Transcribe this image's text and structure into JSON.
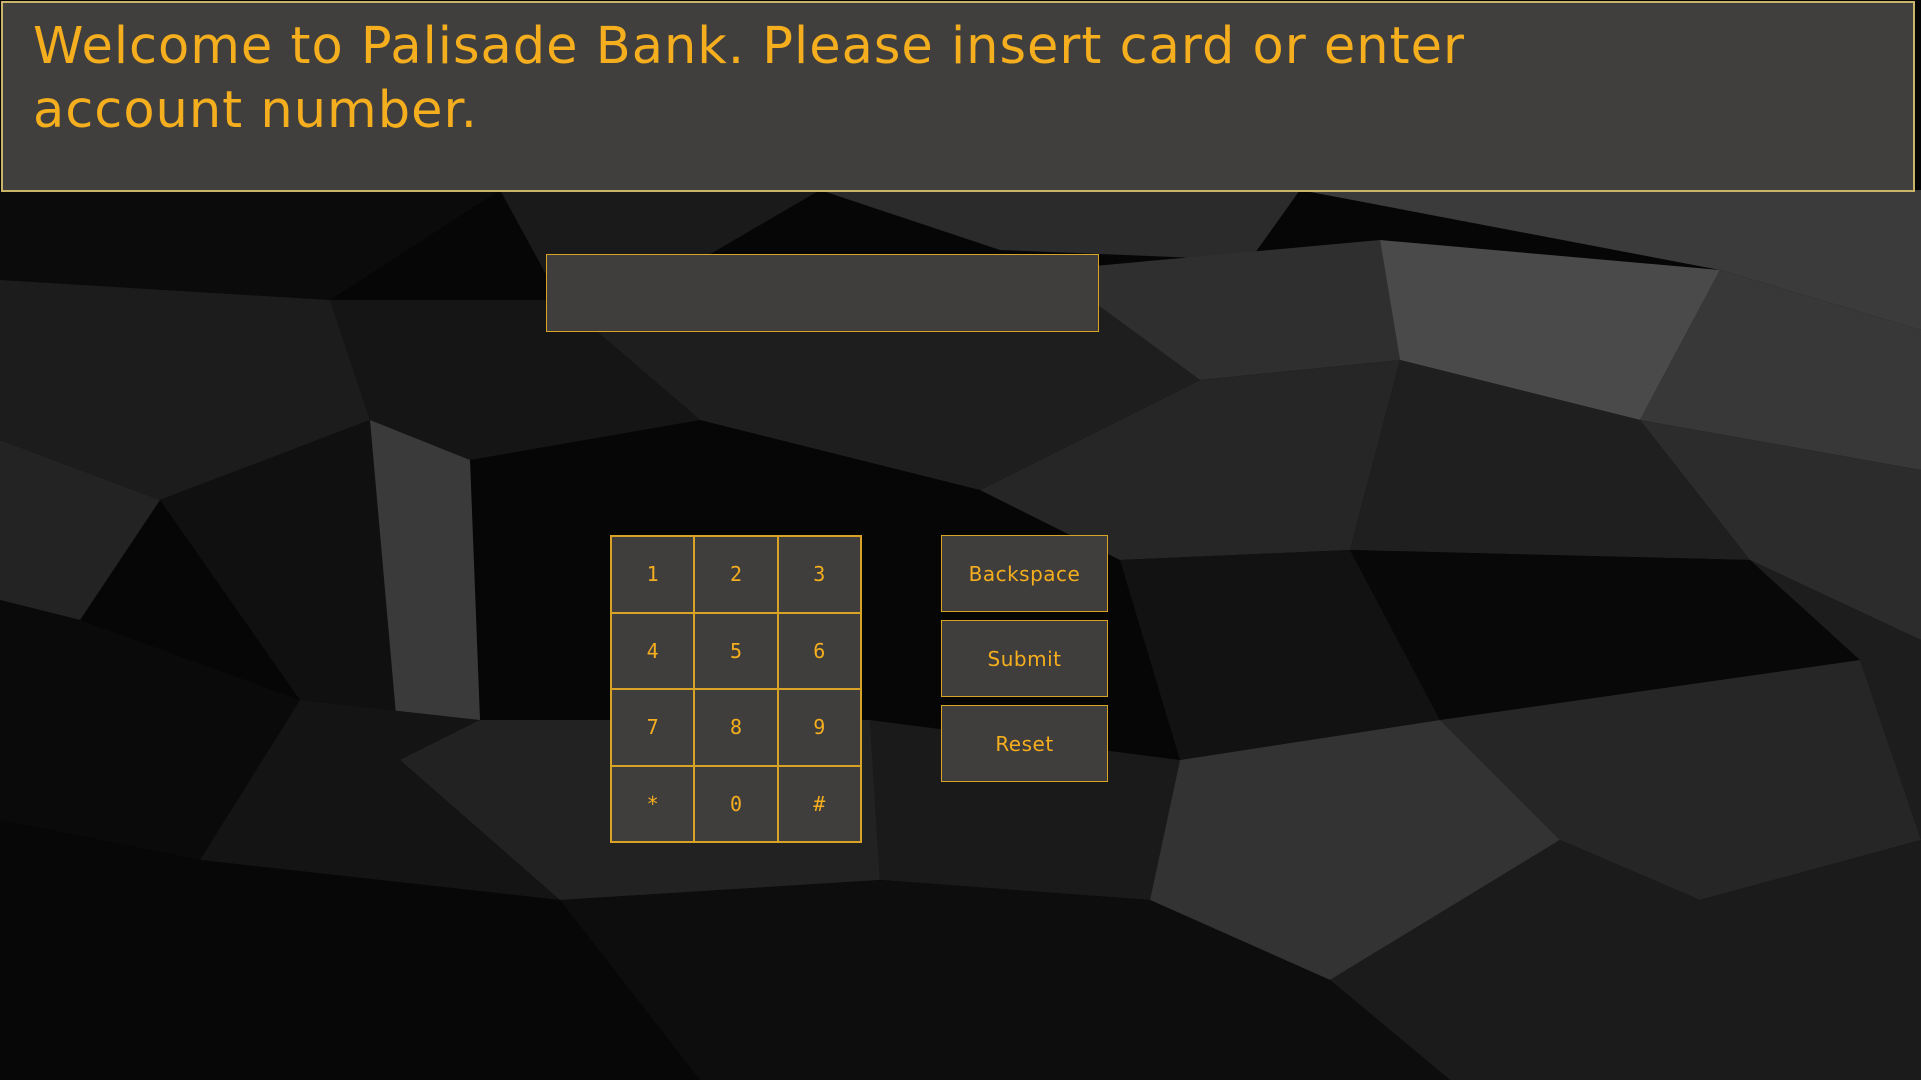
{
  "banner": {
    "message": "Welcome to Palisade Bank. Please insert card or enter account number."
  },
  "account_input": {
    "value": "",
    "placeholder": ""
  },
  "keypad": {
    "keys": [
      "1",
      "2",
      "3",
      "4",
      "5",
      "6",
      "7",
      "8",
      "9",
      "*",
      "0",
      "#"
    ]
  },
  "actions": {
    "backspace_label": "Backspace",
    "submit_label": "Submit",
    "reset_label": "Reset"
  },
  "colors": {
    "accent": "#f5ae1d",
    "border": "#d9a425",
    "panel": "#3f3e3d",
    "banner_border": "#c9b56a"
  }
}
